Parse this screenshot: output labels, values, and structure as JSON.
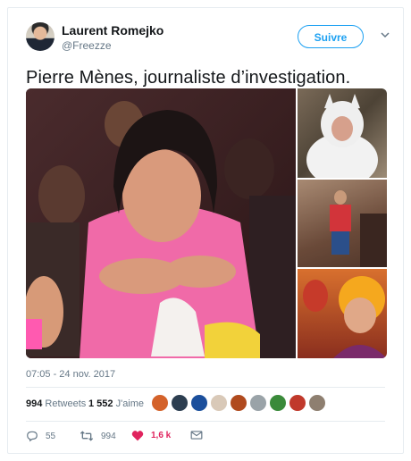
{
  "author": {
    "name": "Laurent Romejko",
    "handle": "@Freezze"
  },
  "header": {
    "follow_label": "Suivre"
  },
  "tweet": {
    "text": "Pierre Mènes, journaliste d’investigation.",
    "timestamp": "07:05 - 24 nov. 2017"
  },
  "stats": {
    "retweets_count": "994",
    "retweets_label": "Retweets",
    "likes_count": "1 552",
    "likes_label": "J'aime"
  },
  "likers": [
    {
      "color": "#d4622a"
    },
    {
      "color": "#2c3e50"
    },
    {
      "color": "#1b4f9c"
    },
    {
      "color": "#d9c9b8"
    },
    {
      "color": "#b04a1e"
    },
    {
      "color": "#9aa3a8"
    },
    {
      "color": "#3a8a3a"
    },
    {
      "color": "#c0392b"
    },
    {
      "color": "#8e7f70"
    }
  ],
  "actions": {
    "replies": "55",
    "retweets": "994",
    "likes": "1,6 k",
    "like_color": "#e0245e"
  },
  "colors": {
    "accent": "#1da1f2",
    "secondary_text": "#657786"
  }
}
